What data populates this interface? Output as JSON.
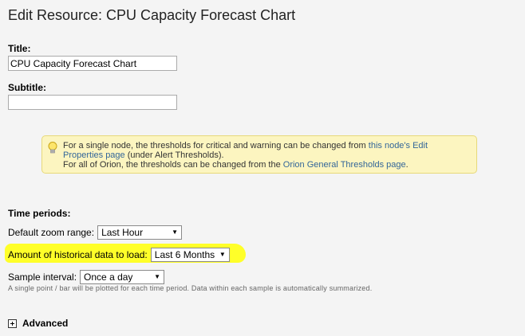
{
  "page": {
    "title": "Edit Resource: CPU Capacity Forecast Chart"
  },
  "form": {
    "title_label": "Title:",
    "title_value": "CPU Capacity Forecast Chart",
    "subtitle_label": "Subtitle:",
    "subtitle_value": ""
  },
  "hint": {
    "icon": "lightbulb-icon",
    "line1_prefix": "For a single node, the thresholds for critical and warning can be changed from ",
    "line1_link": "this node's Edit Properties page",
    "line1_suffix": " (under Alert Thresholds).",
    "line2_prefix": "For all of Orion, the thresholds can be changed from the ",
    "line2_link": "Orion General Thresholds page",
    "line2_suffix": "."
  },
  "time_periods": {
    "heading": "Time periods:",
    "zoom_label": "Default zoom range:",
    "zoom_value": "Last Hour",
    "history_label": "Amount of historical data to load:",
    "history_value": "Last 6 Months",
    "interval_label": "Sample interval:",
    "interval_value": "Once a day",
    "note": "A single point / bar will be plotted for each time period. Data within each sample is automatically summarized."
  },
  "advanced": {
    "label": "Advanced",
    "icon": "expand-plus-icon"
  },
  "colors": {
    "highlight": "#ffff1e",
    "hint_bg": "#fcf5c0",
    "link": "#336699"
  }
}
